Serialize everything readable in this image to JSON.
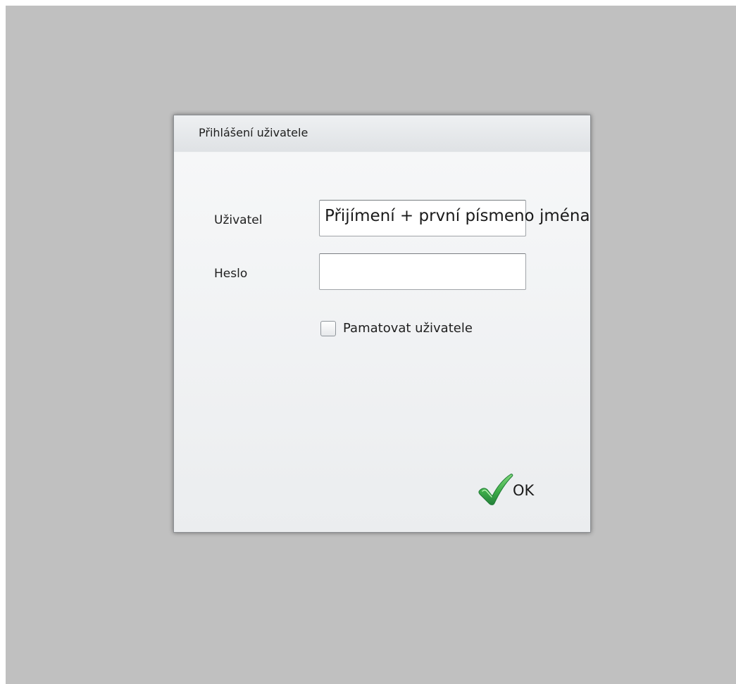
{
  "dialog": {
    "title": "Přihlášení uživatele",
    "user": {
      "label": "Uživatel",
      "value": "Přijímení + první písmeno jména"
    },
    "password": {
      "label": "Heslo",
      "value": ""
    },
    "remember": {
      "label": "Pamatovat uživatele",
      "checked": false
    },
    "ok": {
      "label": "OK",
      "icon": "green-checkmark-icon"
    }
  },
  "colors": {
    "backdrop": "#c0c0c0",
    "checkmark": "#3fae4a"
  }
}
